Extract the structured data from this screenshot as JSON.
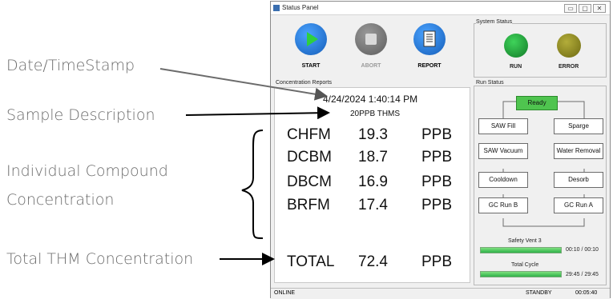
{
  "annotations": {
    "timestamp": "Date/TimeStamp",
    "sample": "Sample Description",
    "compound_line1": "Individual Compound",
    "compound_line2": "Concentration",
    "total": "Total THM Concentration"
  },
  "window": {
    "title": "Status Panel",
    "controls": [
      "▭",
      "▢",
      "✕"
    ]
  },
  "toolbar": {
    "start_label": "START",
    "abort_label": "ABORT",
    "report_label": "REPORT"
  },
  "system_status": {
    "label": "System Status",
    "run_label": "RUN",
    "error_label": "ERROR",
    "run_color": "#1aa035",
    "error_color": "#8f8a1e"
  },
  "report": {
    "label": "Concentration Reports",
    "timestamp": "4/24/2024 1:40:14 PM",
    "sample": "20PPB THMS",
    "compounds": [
      {
        "name": "CHFM",
        "value": "19.3",
        "unit": "PPB"
      },
      {
        "name": "DCBM",
        "value": "18.7",
        "unit": "PPB"
      },
      {
        "name": "DBCM",
        "value": "16.9",
        "unit": "PPB"
      },
      {
        "name": "BRFM",
        "value": "17.4",
        "unit": "PPB"
      }
    ],
    "total": {
      "name": "TOTAL",
      "value": "72.4",
      "unit": "PPB"
    }
  },
  "run_status": {
    "label": "Run Status",
    "ready": "Ready",
    "nodes": [
      "SAW Fill",
      "Sparge",
      "SAW Vacuum",
      "Water Removal",
      "Cooldown",
      "Desorb",
      "GC Run B",
      "GC Run A"
    ],
    "safety_vent_label": "Safety Vent 3",
    "safety_vent_time": "00:10 / 00:10",
    "safety_vent_progress": 1.0,
    "total_cycle_label": "Total Cycle",
    "total_cycle_time": "29:45 / 29:45",
    "total_cycle_progress": 1.0
  },
  "statusbar": {
    "connection": "ONLINE",
    "state": "STANDBY",
    "clock": "00:05:40"
  }
}
